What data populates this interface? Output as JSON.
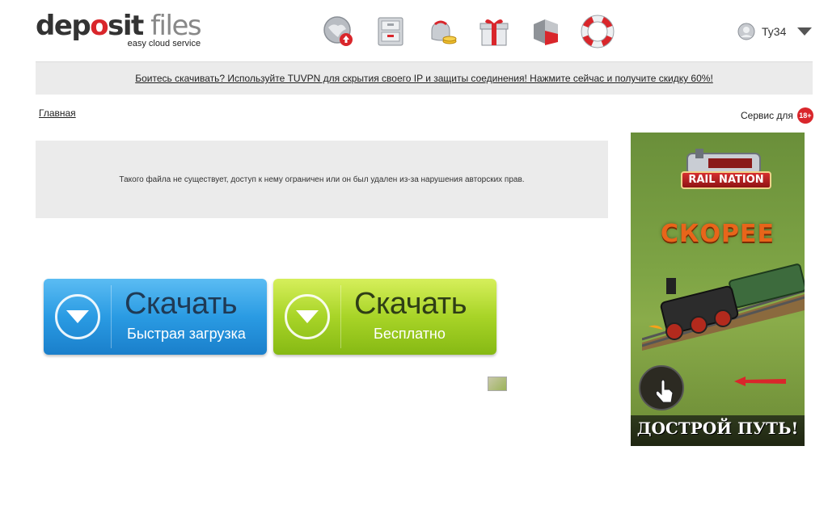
{
  "logo": {
    "part1": "dep",
    "o": "o",
    "part2": "sit",
    "part3": "files",
    "tagline": "easy cloud service"
  },
  "nav": [
    {
      "name": "upload-icon"
    },
    {
      "name": "files-cabinet-icon"
    },
    {
      "name": "wallet-coins-icon"
    },
    {
      "name": "gift-icon"
    },
    {
      "name": "gold-account-icon"
    },
    {
      "name": "lifebuoy-help-icon"
    }
  ],
  "user": {
    "name": "Ty34"
  },
  "banner": {
    "text": "Боитесь скачивать? Используйте TUVPN для скрытия своего IP и защиты соединения! Нажмите сейчас и получите скидку 60%!"
  },
  "breadcrumb": {
    "home": "Главная"
  },
  "service": {
    "label": "Сервис для",
    "age": "18+"
  },
  "message": {
    "text": "Такого файла не существует, доступ к нему ограничен или он был удален из-за нарушения авторских прав."
  },
  "download": {
    "fast": {
      "title": "Скачать",
      "subtitle": "Быстрая загрузка"
    },
    "free": {
      "title": "Скачать",
      "subtitle": "Бесплатно"
    }
  },
  "ad": {
    "brand": "RAIL NATION",
    "headline": "СКОРЕЕ",
    "cta": "ДОСТРОЙ ПУТЬ!"
  },
  "colors": {
    "accent_red": "#d9262b",
    "fast_blue": "#2a9be3",
    "free_green": "#a8d427"
  }
}
